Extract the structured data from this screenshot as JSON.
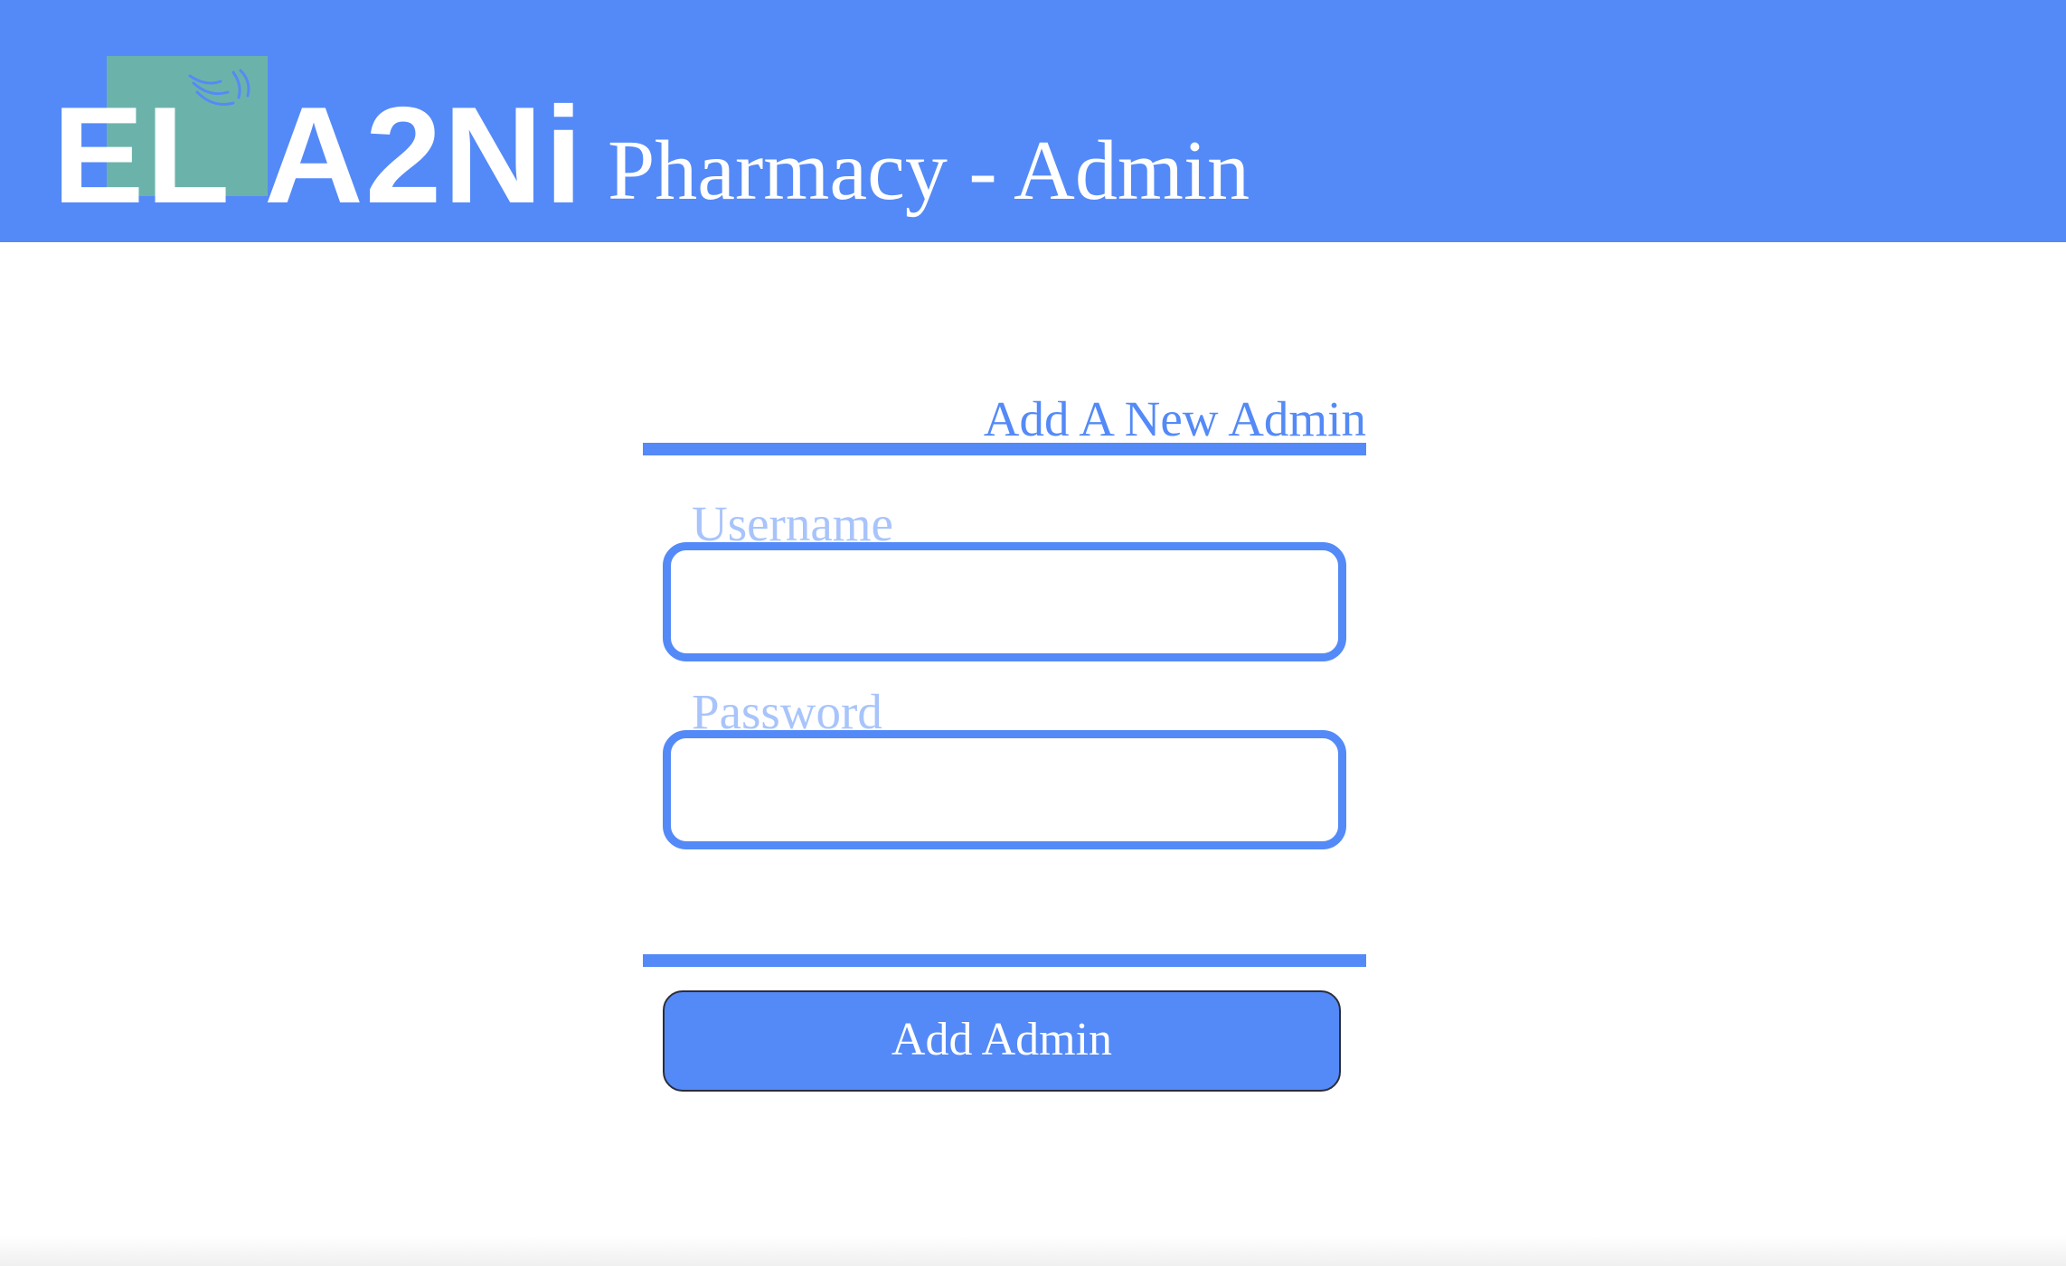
{
  "header": {
    "logo_text": "EL A2Ni",
    "title": "Pharmacy - Admin"
  },
  "form": {
    "title": "Add A New Admin",
    "username": {
      "label": "Username",
      "value": ""
    },
    "password": {
      "label": "Password",
      "value": ""
    },
    "submit_label": "Add Admin"
  },
  "colors": {
    "accent": "#548af7",
    "label_faded": "#a8c4fb",
    "logo_cross": "#6bb3aa"
  },
  "icons": {
    "logo": "pharmacy-cross-icon"
  }
}
